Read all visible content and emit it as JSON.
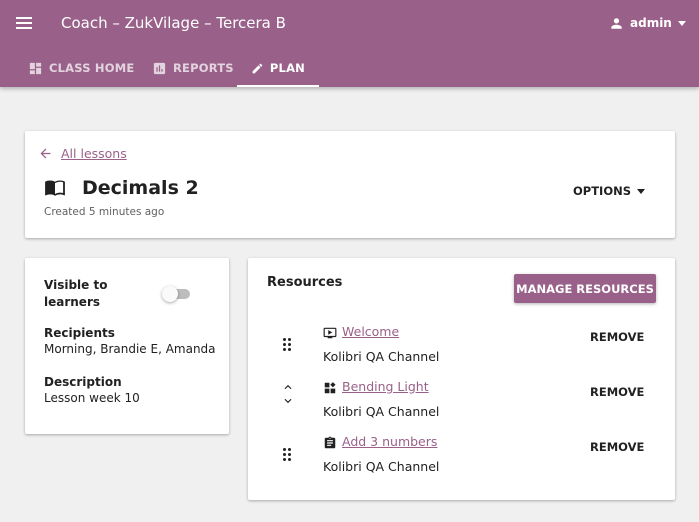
{
  "appbar": {
    "title": "Coach – ZukVilage – Tercera B",
    "menu_icon": "menu-icon",
    "user": {
      "label": "admin",
      "icon": "person-icon"
    },
    "background_color": "#996189"
  },
  "tabs": [
    {
      "label": "CLASS HOME",
      "icon": "dashboard-icon",
      "active": false
    },
    {
      "label": "REPORTS",
      "icon": "bar-chart-icon",
      "active": false
    },
    {
      "label": "PLAN",
      "icon": "pencil-icon",
      "active": true
    }
  ],
  "lesson": {
    "back_label": "All lessons",
    "title": "Decimals 2",
    "created": "Created 5 minutes ago",
    "options_label": "OPTIONS"
  },
  "details": {
    "visible_label": "Visible to learners",
    "visible": false,
    "recipients_label": "Recipients",
    "recipients": "Morning, Brandie E, Amanda",
    "description_label": "Description",
    "description": "Lesson week 10"
  },
  "resources": {
    "title": "Resources",
    "manage_label": "MANAGE RESOURCES",
    "remove_label": "REMOVE",
    "items": [
      {
        "name": "Welcome",
        "channel": "Kolibri QA Channel",
        "icon": "video-icon"
      },
      {
        "name": "Bending Light",
        "channel": "Kolibri QA Channel",
        "icon": "interactive-icon"
      },
      {
        "name": "Add 3 numbers",
        "channel": "Kolibri QA Channel",
        "icon": "exercise-icon"
      }
    ]
  },
  "colors": {
    "accent": "#996189",
    "background": "#f0f0f0"
  }
}
